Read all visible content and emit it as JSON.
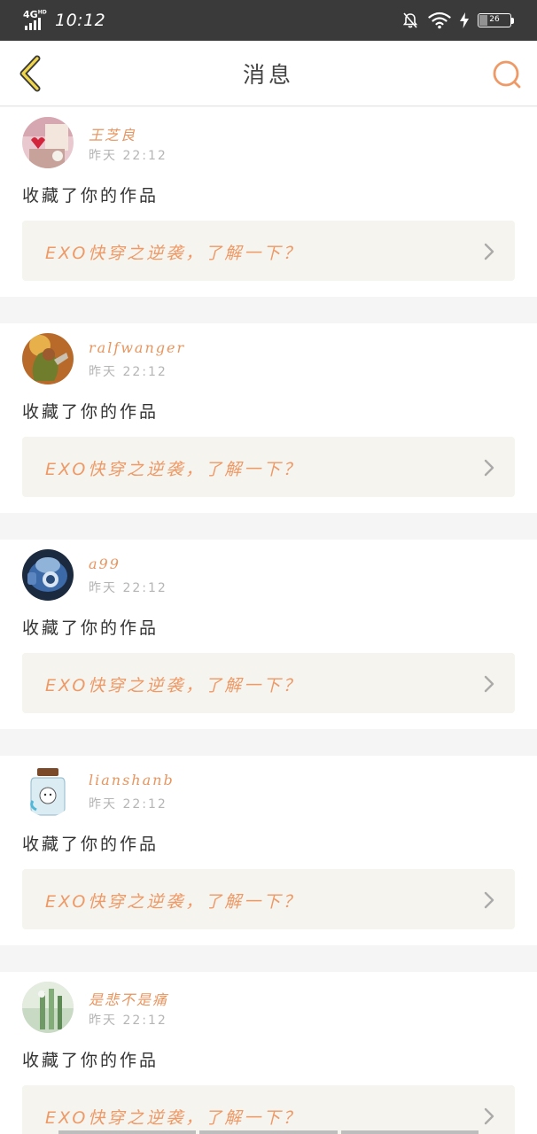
{
  "status_bar": {
    "network": "4G",
    "network_sub": "HD",
    "time": "10:12",
    "battery": "26"
  },
  "nav": {
    "title": "消息",
    "back_icon": "chevron-left-icon",
    "search_icon": "search-icon"
  },
  "messages": [
    {
      "username": "王芝良",
      "time": "昨天  22:12",
      "action": "收藏了你的作品",
      "work_title": "EXO快穿之逆袭，了解一下？",
      "avatar": "avatar-hearts"
    },
    {
      "username": "ralfwanger",
      "time": "昨天  22:12",
      "action": "收藏了你的作品",
      "work_title": "EXO快穿之逆袭，了解一下？",
      "avatar": "avatar-warrior"
    },
    {
      "username": "a99",
      "time": "昨天  22:12",
      "action": "收藏了你的作品",
      "work_title": "EXO快穿之逆袭，了解一下？",
      "avatar": "avatar-robot"
    },
    {
      "username": "lianshanb",
      "time": "昨天  22:12",
      "action": "收藏了你的作品",
      "work_title": "EXO快穿之逆袭，了解一下？",
      "avatar": "avatar-jar"
    },
    {
      "username": "是悲不是痛",
      "time": "昨天  22:12",
      "action": "收藏了你的作品",
      "work_title": "EXO快穿之逆袭，了解一下？",
      "avatar": "avatar-plant"
    }
  ],
  "colors": {
    "accent": "#e8955f",
    "link_bg": "#f5f4ee",
    "status_bar": "#3a3a3a"
  }
}
